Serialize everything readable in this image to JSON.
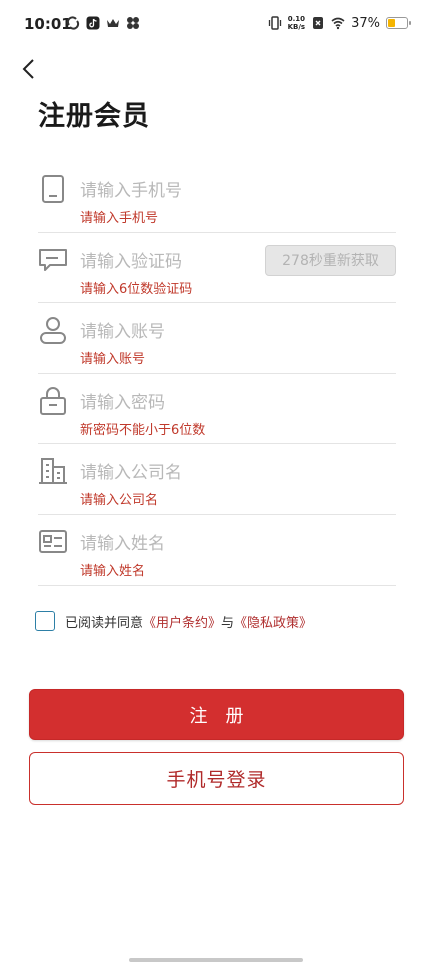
{
  "status_bar": {
    "time": "10:01",
    "net_speed_value": "0.10",
    "net_speed_unit": "KB/s",
    "battery_percent": "37%",
    "battery_level": 0.37,
    "battery_color": "#f5b400"
  },
  "header": {
    "title": "注册会员"
  },
  "form": {
    "fields": [
      {
        "icon": "phone-icon",
        "placeholder": "请输入手机号",
        "hint": "请输入手机号"
      },
      {
        "icon": "message-icon",
        "placeholder": "请输入验证码",
        "hint": "请输入6位数验证码"
      },
      {
        "icon": "user-icon",
        "placeholder": "请输入账号",
        "hint": "请输入账号"
      },
      {
        "icon": "lock-icon",
        "placeholder": "请输入密码",
        "hint": "新密码不能小于6位数"
      },
      {
        "icon": "building-icon",
        "placeholder": "请输入公司名",
        "hint": "请输入公司名"
      },
      {
        "icon": "id-card-icon",
        "placeholder": "请输入姓名",
        "hint": "请输入姓名"
      }
    ],
    "code_button_label": "278秒重新获取"
  },
  "agreement": {
    "prefix": "已阅读并同意",
    "user_terms": "《用户条约》",
    "joiner": "与",
    "privacy_policy": "《隐私政策》",
    "checked": false
  },
  "actions": {
    "register_label": "注册",
    "phone_login_label": "手机号登录"
  },
  "colors": {
    "accent": "#d32f2f",
    "hint": "#c0392b"
  }
}
